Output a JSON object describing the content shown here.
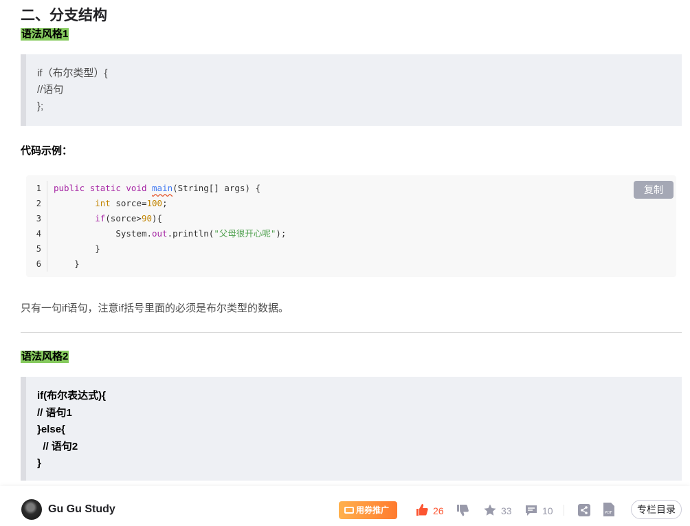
{
  "heading": "二、分支结构",
  "section1": {
    "tag": "语法风格1",
    "quote_lines": [
      "if（布尔类型）{",
      "//语句",
      "};"
    ]
  },
  "example_label": "代码示例：",
  "code_block": {
    "line_numbers": [
      "1",
      "2",
      "3",
      "4",
      "5",
      "6"
    ],
    "copy_label": "复制",
    "lines": [
      {
        "indent": "",
        "tokens": [
          [
            "kw",
            "public "
          ],
          [
            "kw",
            "static "
          ],
          [
            "kw",
            "void "
          ],
          [
            "fn",
            "main"
          ],
          [
            "p",
            "(String[] args) {"
          ]
        ]
      },
      {
        "indent": "        ",
        "tokens": [
          [
            "kt",
            "int "
          ],
          [
            "p",
            "sorce="
          ],
          [
            "num",
            "100"
          ],
          [
            "p",
            ";"
          ]
        ]
      },
      {
        "indent": "        ",
        "tokens": [
          [
            "kw",
            "if"
          ],
          [
            "p",
            "(sorce>"
          ],
          [
            "num",
            "90"
          ],
          [
            "p",
            "){"
          ]
        ]
      },
      {
        "indent": "            ",
        "tokens": [
          [
            "p",
            "System."
          ],
          [
            "fld",
            "out"
          ],
          [
            "p",
            ".println("
          ],
          [
            "str",
            "\"父母很开心呢\""
          ],
          [
            "p",
            ");"
          ]
        ]
      },
      {
        "indent": "        ",
        "tokens": [
          [
            "p",
            "}"
          ]
        ]
      },
      {
        "indent": "    ",
        "tokens": [
          [
            "p",
            "}"
          ]
        ]
      }
    ]
  },
  "paragraph": "只有一句if语句，注意if括号里面的必须是布尔类型的数据。",
  "section2": {
    "tag": "语法风格2",
    "quote_lines": [
      "if(布尔表达式){",
      "// 语句1",
      "}else{",
      "  // 语句2",
      "}"
    ]
  },
  "toolbar": {
    "author": "Gu Gu Study",
    "promo": "用券推广",
    "like_count": "26",
    "star_count": "33",
    "comment_count": "10",
    "toc_label": "专栏目录",
    "like_color": "#fc5531",
    "icons": [
      "thumb-up-icon",
      "thumb-down-icon",
      "star-icon",
      "comment-icon",
      "share-icon",
      "pdf-icon"
    ]
  }
}
